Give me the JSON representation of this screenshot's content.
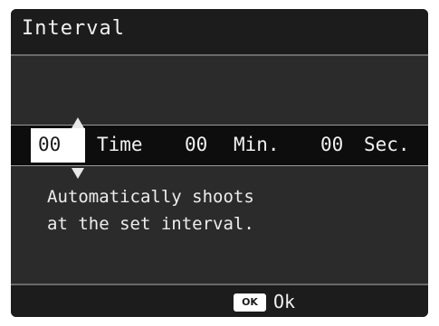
{
  "header": {
    "title": "Interval"
  },
  "interval": {
    "hours_value": "00",
    "hours_unit": "Time",
    "minutes_value": "00",
    "minutes_unit": "Min.",
    "seconds_value": "00",
    "seconds_unit": "Sec."
  },
  "description": {
    "line1": "Automatically shoots",
    "line2": "at the set interval."
  },
  "footer": {
    "ok_key": "OK",
    "ok_label": "Ok"
  },
  "colors": {
    "background": "#2b2b2b",
    "bar": "#1c1c1c",
    "selected_field": "#ffffff"
  },
  "icons": {
    "up": "arrow-up-icon",
    "down": "arrow-down-icon"
  }
}
